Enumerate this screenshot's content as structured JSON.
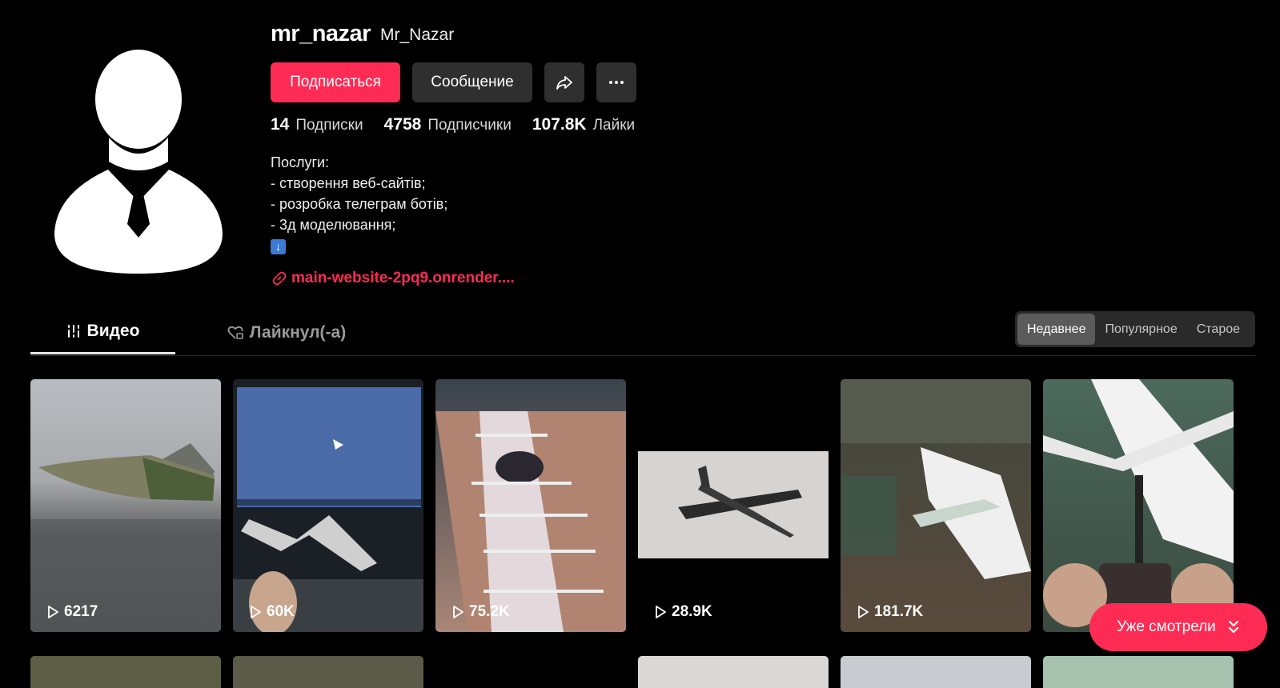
{
  "profile": {
    "username": "mr_nazar",
    "nickname": "Mr_Nazar",
    "follow_label": "Подписаться",
    "message_label": "Сообщение",
    "stats": [
      {
        "value": "14",
        "label": "Подписки"
      },
      {
        "value": "4758",
        "label": "Подписчики"
      },
      {
        "value": "107.8K",
        "label": "Лайки"
      }
    ],
    "bio": [
      "Послуги:",
      "- створення веб-сайтів;",
      "- розробка телеграм ботів;",
      "- 3д моделювання;"
    ],
    "bio_emoji": "⬇️",
    "link": "main-website-2pq9.onrender...."
  },
  "tabs": [
    {
      "label": "Видео",
      "icon": "grid-lines-icon",
      "active": true
    },
    {
      "label": "Лайкнул(-а)",
      "icon": "heart-lock-icon",
      "active": false
    }
  ],
  "sort": [
    {
      "label": "Недавнее",
      "active": true
    },
    {
      "label": "Популярное",
      "active": false
    },
    {
      "label": "Старое",
      "active": false
    }
  ],
  "videos": [
    {
      "views": "6217"
    },
    {
      "views": "60K"
    },
    {
      "views": "75.2K"
    },
    {
      "views": "28.9K"
    },
    {
      "views": "181.7K"
    },
    {
      "views": ""
    }
  ],
  "watched_button": "Уже смотрели",
  "colors": {
    "accent": "#fe2c55",
    "button_dark": "#2f2f2f",
    "background": "#000000"
  }
}
